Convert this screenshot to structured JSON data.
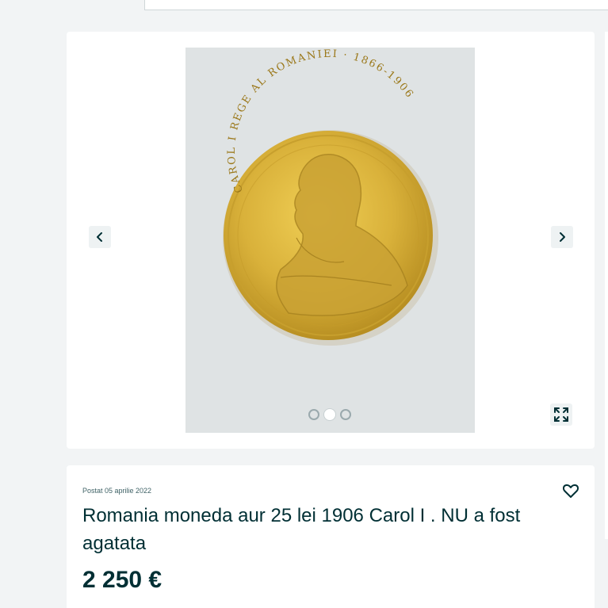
{
  "gallery": {
    "prev_icon": "chevron-left-icon",
    "next_icon": "chevron-right-icon",
    "expand_icon": "expand-icon",
    "dots": [
      {
        "active": false
      },
      {
        "active": true
      },
      {
        "active": false
      }
    ],
    "image_legend": "CAROL I REGE AL ROMANIEI · 1866-1906"
  },
  "listing": {
    "posted": "Postat 05 aprilie 2022",
    "title": "Romania moneda aur 25 lei 1906 Carol I . NU a fost agatata",
    "price": "2 250 €",
    "favorite_icon": "heart-icon"
  },
  "colors": {
    "text_primary": "#002f34",
    "text_secondary": "#406367",
    "page_bg": "#f2f4f5",
    "coin_gold": "#d9b13a"
  }
}
